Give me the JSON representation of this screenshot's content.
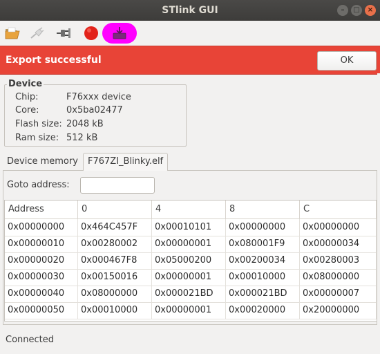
{
  "window": {
    "title": "STlink GUI",
    "controls": [
      "–",
      "□",
      "×"
    ]
  },
  "toolbar": {
    "buttons": [
      {
        "icon": "open-folder-icon"
      },
      {
        "icon": "disconnect-plug-icon"
      },
      {
        "icon": "connect-plug-icon"
      },
      {
        "icon": "record-stop-icon",
        "color": "#e2231a"
      },
      {
        "icon": "export-icon",
        "highlight": "#ff00ff"
      }
    ]
  },
  "infobar": {
    "message": "Export successful",
    "ok_label": "OK",
    "color": "#e84437"
  },
  "device": {
    "group_title": "Device",
    "fields": [
      {
        "key": "Chip:",
        "value": "F76xxx device"
      },
      {
        "key": "Core:",
        "value": "0x5ba02477"
      },
      {
        "key": "Flash size:",
        "value": "2048 kB"
      },
      {
        "key": "Ram size:",
        "value": "512 kB"
      }
    ]
  },
  "tabs": [
    {
      "label": "Device memory",
      "active": false
    },
    {
      "label": "F767ZI_Blinky.elf",
      "active": true
    }
  ],
  "goto": {
    "label": "Goto address:",
    "value": "",
    "placeholder": ""
  },
  "table": {
    "headers": [
      "Address",
      "0",
      "4",
      "8",
      "C"
    ],
    "rows": [
      [
        "0x00000000",
        "0x464C457F",
        "0x00010101",
        "0x00000000",
        "0x00000000"
      ],
      [
        "0x00000010",
        "0x00280002",
        "0x00000001",
        "0x080001F9",
        "0x00000034"
      ],
      [
        "0x00000020",
        "0x000467F8",
        "0x05000200",
        "0x00200034",
        "0x00280003"
      ],
      [
        "0x00000030",
        "0x00150016",
        "0x00000001",
        "0x00010000",
        "0x08000000"
      ],
      [
        "0x00000040",
        "0x08000000",
        "0x000021BD",
        "0x000021BD",
        "0x00000007"
      ],
      [
        "0x00000050",
        "0x00010000",
        "0x00000001",
        "0x00020000",
        "0x20000000"
      ]
    ]
  },
  "status": {
    "text": "Connected"
  }
}
